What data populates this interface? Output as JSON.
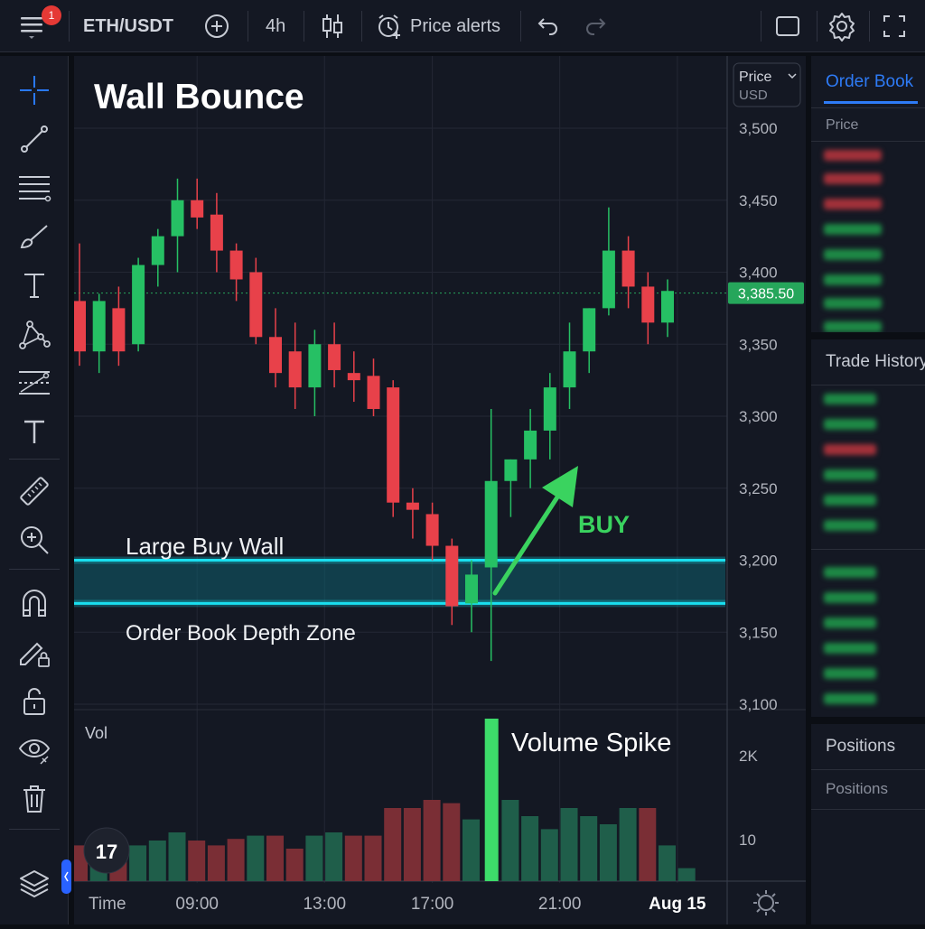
{
  "topbar": {
    "notification_count": "1",
    "symbol": "ETH/USDT",
    "interval": "4h",
    "price_alerts": "Price alerts"
  },
  "chart": {
    "title": "Wall Bounce",
    "price_scale_label": "Price",
    "price_scale_currency": "USD",
    "current_price": "3,385.50",
    "wall_label": "Large Buy Wall",
    "zone_label": "Order Book Depth Zone",
    "buy_label": "BUY",
    "volume_spike_label": "Volume Spike",
    "volume_pane_label": "Vol",
    "time_axis_label": "Time",
    "logo_text": "17",
    "colors": {
      "up": "#26c064",
      "down": "#e8414a",
      "wall": "#19e0f0",
      "accent": "#2979ff",
      "buy": "#3ad35f"
    }
  },
  "chart_data": {
    "type": "candlestick",
    "title": "Wall Bounce",
    "y_ticks": [
      "3,500",
      "3,450",
      "3,400",
      "3,350",
      "3,300",
      "3,250",
      "3,200",
      "3,150",
      "3,100"
    ],
    "y_tick_values": [
      3500,
      3450,
      3400,
      3350,
      3300,
      3250,
      3200,
      3150,
      3100
    ],
    "ylim": [
      3100,
      3500
    ],
    "x_ticks": [
      "09:00",
      "13:00",
      "17:00",
      "21:00",
      "Aug 15"
    ],
    "x_tick_index": [
      6,
      12.5,
      18,
      24.5,
      30.5
    ],
    "last_price": 3385.5,
    "buy_wall_range": [
      3170,
      3200
    ],
    "candles": [
      {
        "o": 3380,
        "h": 3420,
        "l": 3335,
        "c": 3345
      },
      {
        "o": 3345,
        "h": 3385,
        "l": 3330,
        "c": 3380
      },
      {
        "o": 3375,
        "h": 3390,
        "l": 3335,
        "c": 3345
      },
      {
        "o": 3350,
        "h": 3410,
        "l": 3345,
        "c": 3405
      },
      {
        "o": 3405,
        "h": 3430,
        "l": 3390,
        "c": 3425
      },
      {
        "o": 3425,
        "h": 3465,
        "l": 3400,
        "c": 3450
      },
      {
        "o": 3450,
        "h": 3465,
        "l": 3430,
        "c": 3438
      },
      {
        "o": 3440,
        "h": 3455,
        "l": 3400,
        "c": 3415
      },
      {
        "o": 3415,
        "h": 3420,
        "l": 3380,
        "c": 3395
      },
      {
        "o": 3400,
        "h": 3410,
        "l": 3350,
        "c": 3355
      },
      {
        "o": 3355,
        "h": 3375,
        "l": 3320,
        "c": 3330
      },
      {
        "o": 3345,
        "h": 3365,
        "l": 3305,
        "c": 3320
      },
      {
        "o": 3320,
        "h": 3360,
        "l": 3300,
        "c": 3350
      },
      {
        "o": 3350,
        "h": 3365,
        "l": 3320,
        "c": 3332
      },
      {
        "o": 3330,
        "h": 3345,
        "l": 3310,
        "c": 3325
      },
      {
        "o": 3328,
        "h": 3340,
        "l": 3300,
        "c": 3305
      },
      {
        "o": 3320,
        "h": 3325,
        "l": 3230,
        "c": 3240
      },
      {
        "o": 3240,
        "h": 3250,
        "l": 3215,
        "c": 3235
      },
      {
        "o": 3232,
        "h": 3240,
        "l": 3200,
        "c": 3210
      },
      {
        "o": 3210,
        "h": 3215,
        "l": 3155,
        "c": 3168
      },
      {
        "o": 3170,
        "h": 3200,
        "l": 3150,
        "c": 3190
      },
      {
        "o": 3195,
        "h": 3305,
        "l": 3130,
        "c": 3255
      },
      {
        "o": 3255,
        "h": 3270,
        "l": 3230,
        "c": 3270
      },
      {
        "o": 3270,
        "h": 3305,
        "l": 3250,
        "c": 3290
      },
      {
        "o": 3290,
        "h": 3330,
        "l": 3270,
        "c": 3320
      },
      {
        "o": 3320,
        "h": 3365,
        "l": 3305,
        "c": 3345
      },
      {
        "o": 3345,
        "h": 3375,
        "l": 3330,
        "c": 3375
      },
      {
        "o": 3375,
        "h": 3445,
        "l": 3370,
        "c": 3415
      },
      {
        "o": 3415,
        "h": 3425,
        "l": 3375,
        "c": 3390
      },
      {
        "o": 3390,
        "h": 3400,
        "l": 3350,
        "c": 3365
      },
      {
        "o": 3365,
        "h": 3395,
        "l": 3355,
        "c": 3387
      }
    ],
    "volume_ticks": [
      "2K",
      "10"
    ],
    "volume": [
      {
        "v": 0.22,
        "dir": "down"
      },
      {
        "v": 0.25,
        "dir": "up"
      },
      {
        "v": 0.22,
        "dir": "down"
      },
      {
        "v": 0.22,
        "dir": "up"
      },
      {
        "v": 0.25,
        "dir": "up"
      },
      {
        "v": 0.3,
        "dir": "up"
      },
      {
        "v": 0.25,
        "dir": "down"
      },
      {
        "v": 0.22,
        "dir": "down"
      },
      {
        "v": 0.26,
        "dir": "down"
      },
      {
        "v": 0.28,
        "dir": "up"
      },
      {
        "v": 0.28,
        "dir": "down"
      },
      {
        "v": 0.2,
        "dir": "down"
      },
      {
        "v": 0.28,
        "dir": "up"
      },
      {
        "v": 0.3,
        "dir": "up"
      },
      {
        "v": 0.28,
        "dir": "down"
      },
      {
        "v": 0.28,
        "dir": "down"
      },
      {
        "v": 0.45,
        "dir": "down"
      },
      {
        "v": 0.45,
        "dir": "down"
      },
      {
        "v": 0.5,
        "dir": "down"
      },
      {
        "v": 0.48,
        "dir": "down"
      },
      {
        "v": 0.38,
        "dir": "up"
      },
      {
        "v": 1.0,
        "dir": "spike"
      },
      {
        "v": 0.5,
        "dir": "up"
      },
      {
        "v": 0.4,
        "dir": "up"
      },
      {
        "v": 0.32,
        "dir": "up"
      },
      {
        "v": 0.45,
        "dir": "up"
      },
      {
        "v": 0.4,
        "dir": "up"
      },
      {
        "v": 0.35,
        "dir": "up"
      },
      {
        "v": 0.45,
        "dir": "up"
      },
      {
        "v": 0.45,
        "dir": "down"
      },
      {
        "v": 0.22,
        "dir": "up"
      },
      {
        "v": 0.08,
        "dir": "up"
      }
    ]
  },
  "right_panel": {
    "order_book_tab": "Order Book",
    "order_book_col": "Price",
    "trade_history_title": "Trade History",
    "positions_title": "Positions",
    "positions_tab": "Positions"
  }
}
